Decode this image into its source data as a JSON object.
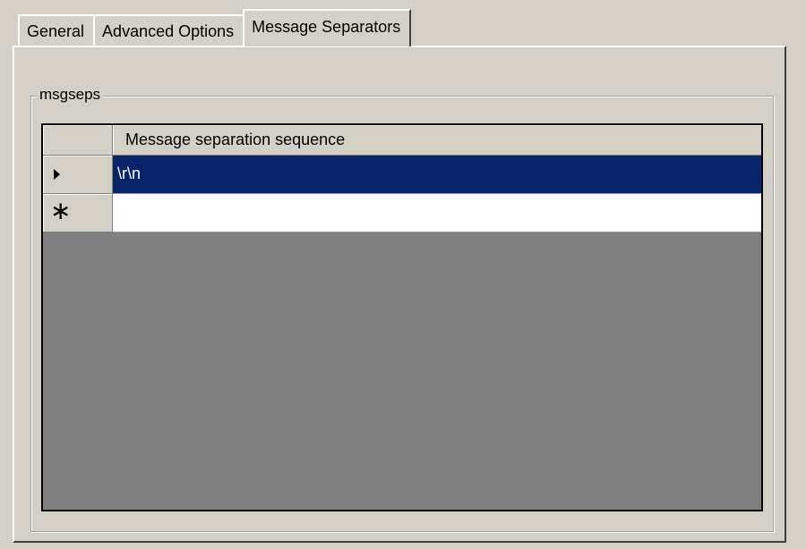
{
  "tabs": [
    {
      "label": "General"
    },
    {
      "label": "Advanced Options"
    },
    {
      "label": "Message Separators"
    }
  ],
  "active_tab": "Message Separators",
  "group": {
    "title": "msgseps"
  },
  "grid": {
    "columns": [
      {
        "header": "Message separation sequence"
      }
    ],
    "rows": [
      {
        "indicator": "current-row-arrow-icon",
        "value": "\\r\\n",
        "selected": true
      },
      {
        "indicator": "new-row-asterisk-icon",
        "value": "",
        "selected": false
      }
    ],
    "new_row_glyph": "∗"
  },
  "colors": {
    "selection_background": "#0a246a",
    "selection_text": "#ffffff",
    "grid_background": "#808080",
    "window_background": "#d4d0c8"
  }
}
